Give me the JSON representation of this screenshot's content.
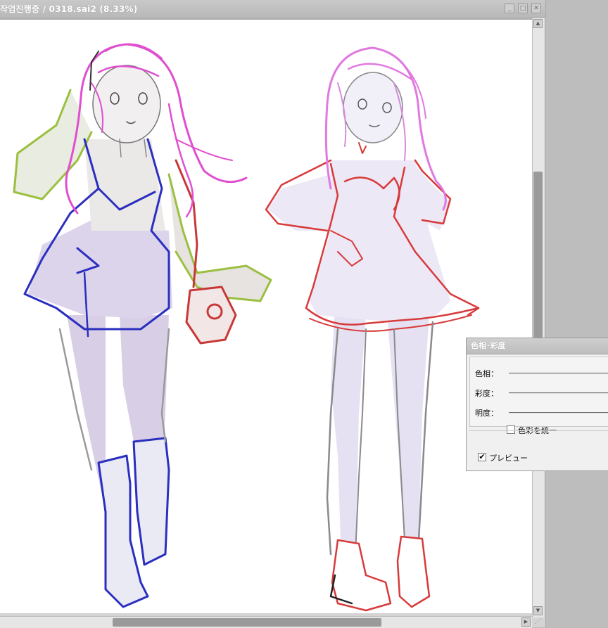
{
  "window": {
    "title": "작업진행중 / 0318.sai2 (8.33%)",
    "minimize_glyph": "_",
    "maximize_glyph": "□",
    "close_glyph": "✕"
  },
  "scrollbars": {
    "up_glyph": "▲",
    "down_glyph": "▼",
    "right_glyph": "▶"
  },
  "dialog": {
    "title": "色相･彩度",
    "hue_label": "色相：",
    "saturation_label": "彩度：",
    "brightness_label": "明度：",
    "unify_label": "色彩を統一",
    "unify_checked": false,
    "preview_label": "プレビュー",
    "preview_checked": true,
    "check_glyph": "✔"
  },
  "colors": {
    "hair": "#e04fd0",
    "jacket": "#9bbf3f",
    "dress_outline_left": "#2b2fbf",
    "dress_outline_right": "#d83a3a",
    "bag": "#c83838",
    "skin_fill": "#dcd4e8",
    "pencil": "#8a8a8a"
  }
}
